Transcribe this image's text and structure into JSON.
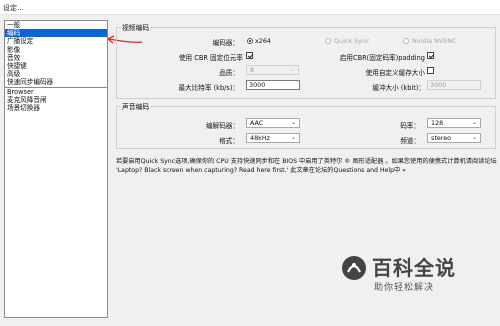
{
  "window": {
    "title": "设定..."
  },
  "categories": [
    {
      "label": "一般",
      "selected": false
    },
    {
      "label": "编码",
      "selected": true
    },
    {
      "label": "广播设定",
      "selected": false
    },
    {
      "label": "影像",
      "selected": false
    },
    {
      "label": "音效",
      "selected": false
    },
    {
      "label": "快捷键",
      "selected": false
    },
    {
      "label": "高级",
      "selected": false
    },
    {
      "label": "快速同步编码器",
      "selected": false
    },
    {
      "label": "Browser",
      "selected": false
    },
    {
      "label": "麦克风降音闸",
      "selected": false
    },
    {
      "label": "场景切换器",
      "selected": false
    }
  ],
  "video": {
    "group_title": "视频编码",
    "encoder_label": "编码器：",
    "encoder_options": [
      {
        "label": "x264",
        "selected": true,
        "enabled": true
      },
      {
        "label": "Quick Sync",
        "selected": false,
        "enabled": false
      },
      {
        "label": "Nvidia NVENC",
        "selected": false,
        "enabled": false
      }
    ],
    "cbr_label": "使用 CBR 固定位元率",
    "cbr_checked": true,
    "cbr_padding_label": "启用CBR(固定码率)padding",
    "cbr_padding_checked": true,
    "quality_label": "品质：",
    "quality_value": "8",
    "custom_buffer_label": "使用自定义缓存大小",
    "custom_buffer_checked": false,
    "max_bitrate_label": "最大比特率 (kb/s)：",
    "max_bitrate_value": "3000",
    "buffer_size_label": "缓冲大小 (kbit)：",
    "buffer_size_value": "3000"
  },
  "audio": {
    "group_title": "声音编码",
    "codec_label": "编解码器：",
    "codec_value": "AAC",
    "bitrate_label": "码率：",
    "bitrate_value": "128",
    "format_label": "格式：",
    "format_value": "48kHz",
    "channels_label": "频道：",
    "channels_value": "stereo"
  },
  "info_text": "若要启用Quick Sync选项,确保你的 CPU 支持快速同步和在 BIOS 中启用了英特尔 ® 图形适配器 。如果您使用的便携式计算机请阅读论坛 'Laptop? Black screen when capturing? Read here first.' 此文章在论坛的Questions and Help中 »",
  "watermark": {
    "title": "百科全说",
    "subtitle": "助你轻松解决"
  },
  "colors": {
    "selection": "#0a64d6",
    "annotation_arrow": "#e0262b"
  }
}
